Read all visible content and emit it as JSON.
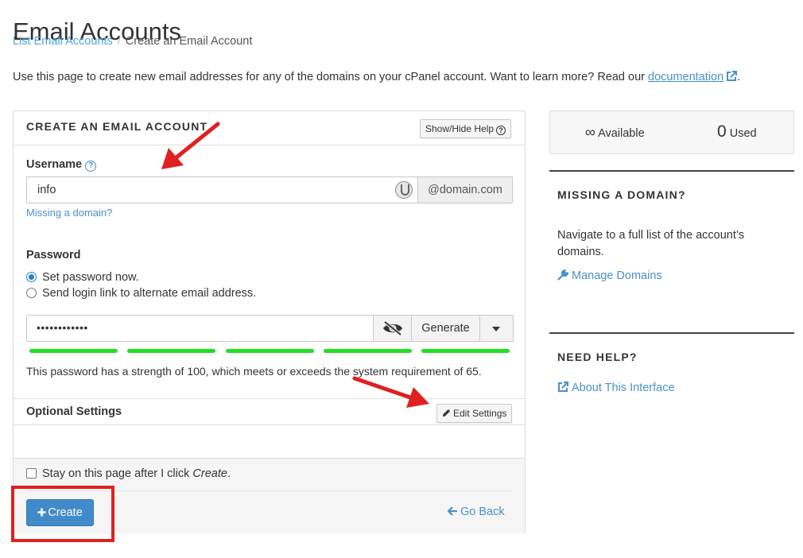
{
  "page": {
    "title": "Email Accounts",
    "breadcrumb": {
      "link": "List Email Accounts",
      "current": "Create an Email Account"
    },
    "intro_text": "Use this page to create new email addresses for any of the domains on your cPanel account. Want to learn more? Read our ",
    "doc_link": "documentation",
    "intro_end": "."
  },
  "form": {
    "panel_title": "CREATE AN EMAIL ACCOUNT",
    "help_button": "Show/Hide Help",
    "username_label": "Username",
    "username_value": "info",
    "domain": "@domain.com",
    "missing_domain": "Missing a domain?",
    "password_label": "Password",
    "radio_set_now": "Set password now.",
    "radio_send_link": "Send login link to alternate email address.",
    "password_masked": "••••••••••••",
    "generate": "Generate",
    "strength_segments": 5,
    "strength_message": "This password has a strength of 100, which meets or exceeds the system requirement of 65.",
    "optional_settings": "Optional Settings",
    "edit_settings": "Edit Settings",
    "stay_text": "Stay on this page after I click ",
    "stay_em": "Create",
    "stay_end": ".",
    "create_button": "Create",
    "go_back": "Go Back"
  },
  "sidebar": {
    "available_symbol": "∞",
    "available_label": "Available",
    "used_count": "0",
    "used_label": "Used",
    "missing_title": "MISSING A DOMAIN?",
    "missing_text": "Navigate to a full list of the account’s domains.",
    "manage_domains": "Manage Domains",
    "help_title": "NEED HELP?",
    "about_link": "About This Interface"
  },
  "colors": {
    "link": "#4a90c8",
    "primary_button": "#428bca",
    "strength_bar": "#21e021",
    "annotation_red": "#e02020"
  }
}
